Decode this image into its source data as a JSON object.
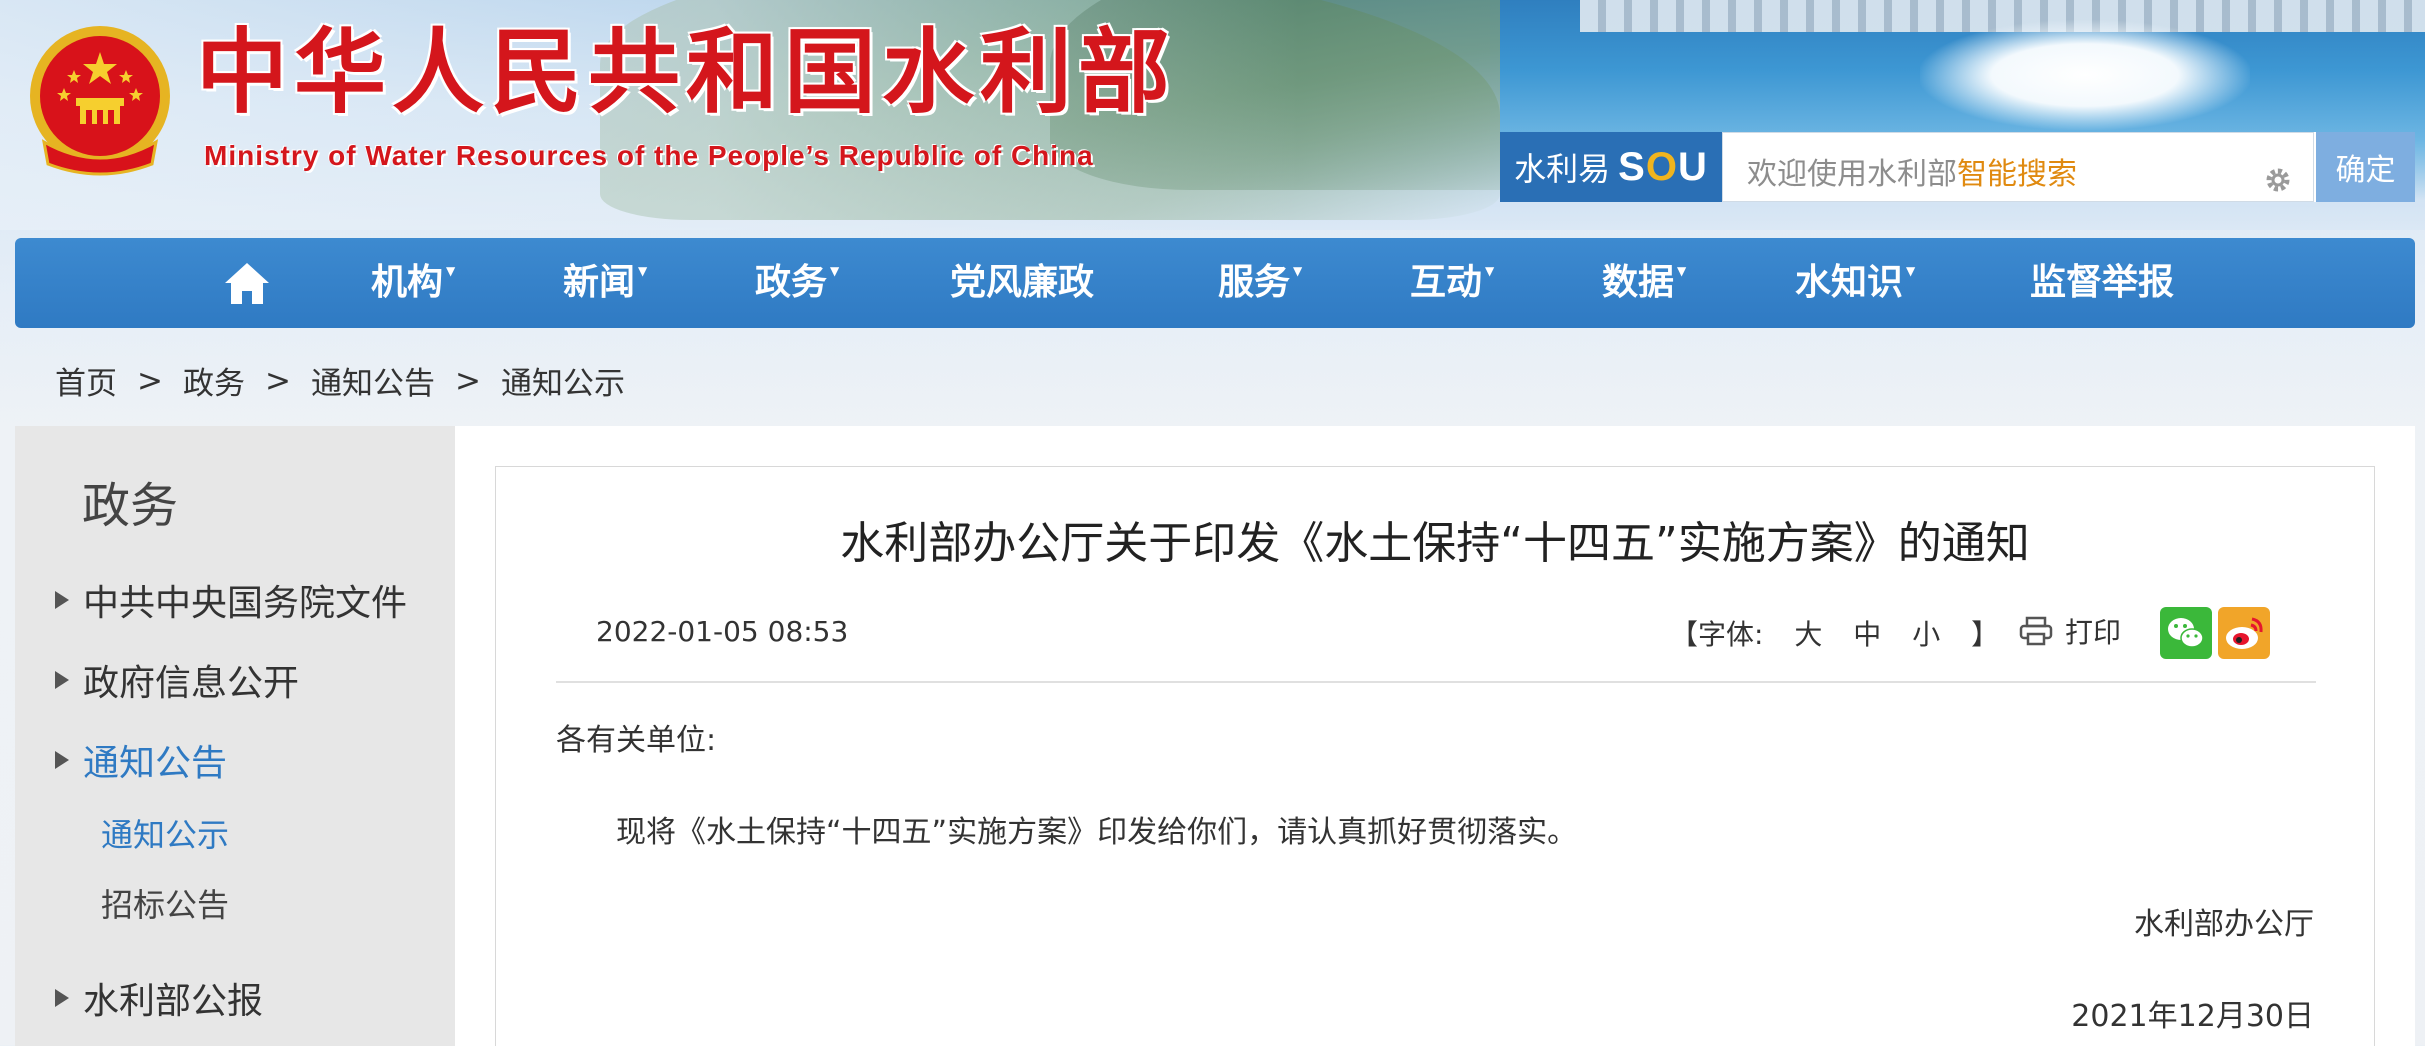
{
  "header": {
    "title_cn": "中华人民共和国水利部",
    "title_en": "Ministry of Water Resources of the People’s Republic of China"
  },
  "search": {
    "logo_prefix": "水利易",
    "logo_sou": "SOU",
    "placeholder_prefix": "欢迎使用水利部",
    "placeholder_highlight": "智能搜索",
    "button_label": "确定"
  },
  "nav": {
    "items": [
      {
        "label": "机构",
        "caret": "▼"
      },
      {
        "label": "新闻",
        "caret": "▼"
      },
      {
        "label": "政务",
        "caret": "▼"
      },
      {
        "label": "党风廉政",
        "caret": ""
      },
      {
        "label": "服务",
        "caret": "▼"
      },
      {
        "label": "互动",
        "caret": "▼"
      },
      {
        "label": "数据",
        "caret": "▼"
      },
      {
        "label": "水知识",
        "caret": "▼"
      },
      {
        "label": "监督举报",
        "caret": ""
      }
    ]
  },
  "breadcrumb": {
    "items": [
      "首页",
      "政务",
      "通知公告",
      "通知公示"
    ],
    "separator": ">"
  },
  "sidebar": {
    "title": "政务",
    "items": [
      {
        "label": "中共中央国务院文件"
      },
      {
        "label": "政府信息公开"
      },
      {
        "label": "通知公告"
      },
      {
        "label": "水利部公报"
      }
    ],
    "subitems": [
      "通知公示",
      "招标公告"
    ]
  },
  "article": {
    "title": "水利部办公厅关于印发《水土保持“十四五”实施方案》的通知",
    "datetime": "2022-01-05 08:53",
    "font_label_open": "【字体:",
    "font_large": "大",
    "font_medium": "中",
    "font_small": "小",
    "font_label_close": "】",
    "print_label": "打印",
    "greeting": "各有关单位:",
    "body": "现将《水土保持“十四五”实施方案》印发给你们，请认真抓好贯彻落实。",
    "signature": "水利部办公厅",
    "sign_date": "2021年12月30日"
  },
  "colors": {
    "brand_red": "#d4161c",
    "nav_blue": "#2f7ac3",
    "active_link": "#2f7ac3",
    "search_highlight": "#e08a10"
  },
  "icons": {
    "home": "home-icon",
    "print": "printer-icon",
    "wechat": "wechat-icon",
    "weibo": "weibo-icon",
    "emblem": "national-emblem-icon",
    "search_settings": "gear-icon"
  }
}
